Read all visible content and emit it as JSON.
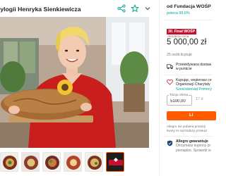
{
  "offer": {
    "title": "rylogii Henryka Sienkiewicza"
  },
  "header_icons": [
    "share-icon",
    "star-icon",
    "chevron-down-icon"
  ],
  "seller": {
    "name": "od Fundacja WOŚP",
    "recommend": "poleca 99,6%"
  },
  "pricing": {
    "badge": "30. Finał WOŚP",
    "label": "Aktualna cena",
    "amount": "5 000,00 zł",
    "offers_count": "25 osób licytuje"
  },
  "delivery": {
    "line1": "Przewidywana dostaw",
    "line2": "w punkcie"
  },
  "charity": {
    "line1": "Kupując, wspierasz ce",
    "line2": "Organizacji Charytaty",
    "line3": "Sześćdziesiąt Pomocy"
  },
  "bid": {
    "label": "Twoja oferta",
    "value": "5100,00",
    "hint": "17 d",
    "button_label": "Li"
  },
  "fine_print": {
    "line1": "Allegro nie pobiera prowizji",
    "line2": "kwoty ze sprzedaży przekaz"
  },
  "guarantee": {
    "line1": "Allegro gwarantuje",
    "line2": "Otrzymasz kupiony pr",
    "line3": "pieniądze. Sprawdź w"
  },
  "colors": {
    "accent": "#ff5a00",
    "teal": "#00a790",
    "badge": "#c8102e"
  }
}
